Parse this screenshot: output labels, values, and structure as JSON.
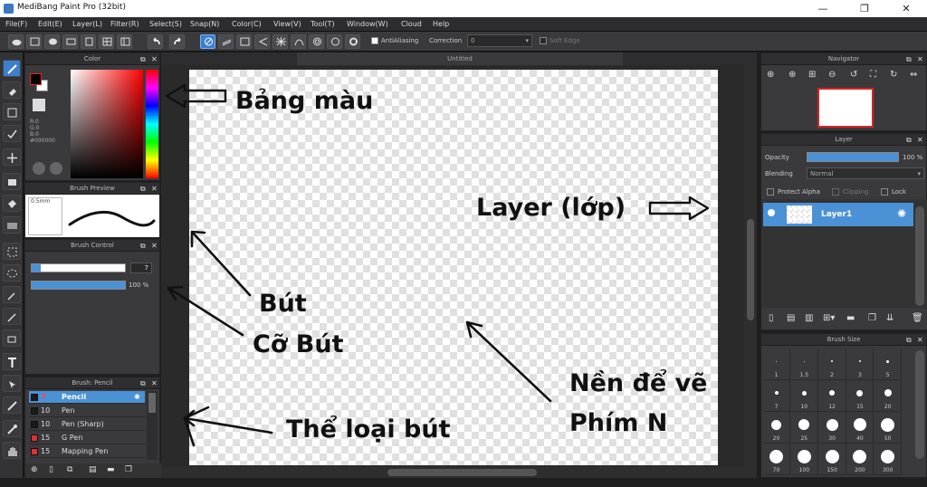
{
  "window": {
    "title": "MediBang Paint Pro (32bit)",
    "minimize": "—",
    "restore": "❐",
    "close": "✕"
  },
  "menu": [
    "File(F)",
    "Edit(E)",
    "Layer(L)",
    "Filter(R)",
    "Select(S)",
    "Snap(N)",
    "Color(C)",
    "View(V)",
    "Tool(T)",
    "Window(W)",
    "Cloud",
    "Help"
  ],
  "toolbar": {
    "antialiasing": "AntiAliasing",
    "correction_label": "Correction",
    "correction_value": "0",
    "soft_edge": "Soft Edge"
  },
  "color_panel": {
    "title": "Color",
    "r": "R:0",
    "g": "G:0",
    "b": "B:0",
    "hex": "#000000"
  },
  "brush_preview": {
    "title": "Brush Preview",
    "size_text": "0.5mm"
  },
  "brush_control": {
    "title": "Brush Control",
    "size_value": "7",
    "opacity_value": "100 %"
  },
  "brush_list": {
    "title": "Brush: Pencil",
    "items": [
      {
        "size": "7",
        "name": "Pencil",
        "color": "#1a1a1a",
        "selected": true
      },
      {
        "size": "10",
        "name": "Pen",
        "color": "#1a1a1a",
        "selected": false
      },
      {
        "size": "10",
        "name": "Pen (Sharp)",
        "color": "#1a1a1a",
        "selected": false
      },
      {
        "size": "15",
        "name": "G Pen",
        "color": "#e03030",
        "selected": false
      },
      {
        "size": "15",
        "name": "Mapping Pen",
        "color": "#e03030",
        "selected": false
      }
    ]
  },
  "canvas": {
    "tab": "Untitled"
  },
  "navigator": {
    "title": "Navigator"
  },
  "layer_panel": {
    "title": "Layer",
    "opacity_label": "Opacity",
    "opacity_value": "100 %",
    "blending_label": "Blending",
    "blending_value": "Normal",
    "protect_alpha": "Protect Alpha",
    "clipping": "Clipping",
    "lock": "Lock",
    "layer_name": "Layer1"
  },
  "brush_size_panel": {
    "title": "Brush Size",
    "rows": [
      [
        "1",
        "1.5",
        "2",
        "3",
        "5"
      ],
      [
        "7",
        "10",
        "12",
        "15",
        "20"
      ],
      [
        "20",
        "25",
        "30",
        "40",
        "50"
      ],
      [
        "70",
        "100",
        "150",
        "200",
        "300"
      ]
    ]
  },
  "annotations": {
    "color_table": "Bảng màu",
    "layer": "Layer (lớp)",
    "pen": "Bút",
    "pen_size": "Cỡ Bút",
    "canvas": "Nền để vẽ",
    "key": "Phím N",
    "pen_type": "Thể loại bút"
  },
  "colors": {
    "accent": "#3b7fcf",
    "panel_bg": "#3a3a3d",
    "canvas_bg": "#2a2a2a"
  }
}
